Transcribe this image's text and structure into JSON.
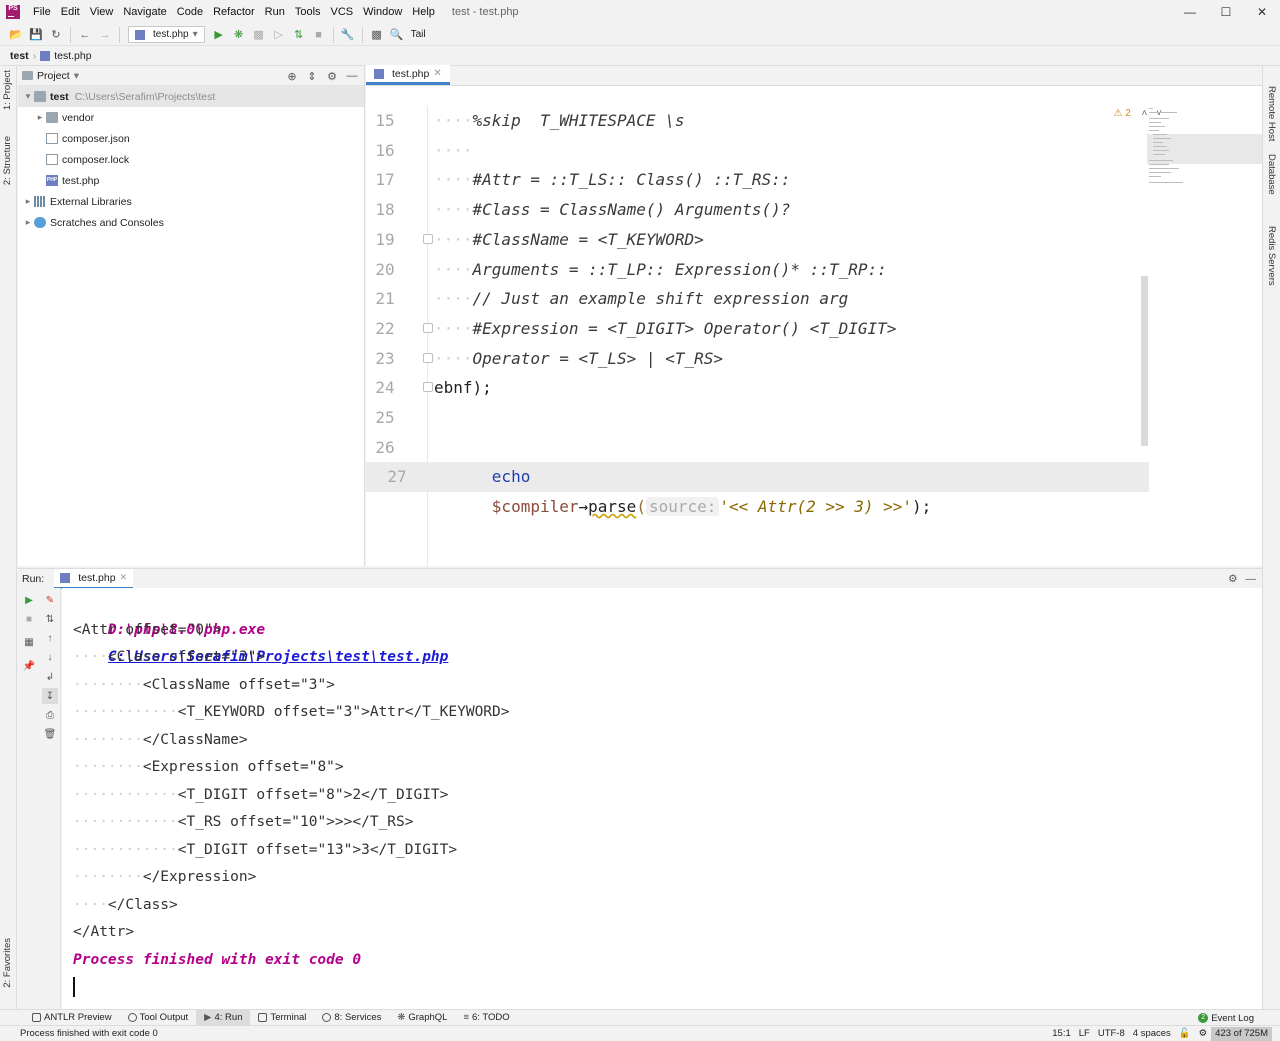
{
  "window": {
    "title": "test - test.php"
  },
  "menu": [
    "File",
    "Edit",
    "View",
    "Navigate",
    "Code",
    "Refactor",
    "Run",
    "Tools",
    "VCS",
    "Window",
    "Help"
  ],
  "toolbar": {
    "run_config": "test.php",
    "tail_label": "Tail"
  },
  "breadcrumb": [
    "test",
    "test.php"
  ],
  "left_stripe": {
    "project": "1: Project",
    "structure": "2: Structure",
    "favorites": "2: Favorites"
  },
  "right_stripe": [
    "Remote Host",
    "Database",
    "Redis Servers"
  ],
  "project": {
    "header": "Project",
    "root": {
      "name": "test",
      "path": "C:\\Users\\Serafim\\Projects\\test"
    },
    "items": [
      {
        "name": "vendor",
        "type": "folder"
      },
      {
        "name": "composer.json",
        "type": "json"
      },
      {
        "name": "composer.lock",
        "type": "lock"
      },
      {
        "name": "test.php",
        "type": "php"
      }
    ],
    "external_libraries": "External Libraries",
    "scratches": "Scratches and Consoles"
  },
  "editor": {
    "tab": "test.php",
    "warning_count": "2",
    "lines": [
      15,
      16,
      17,
      18,
      19,
      20,
      21,
      22,
      23,
      24,
      25,
      26,
      27
    ],
    "code": {
      "l15": "%skip  T_WHITESPACE \\s",
      "l17": "#Attr = ::T_LS:: Class() ::T_RS::",
      "l18": "#Class = ClassName() Arguments()?",
      "l19": "#ClassName = <T_KEYWORD>",
      "l20": "Arguments = ::T_LP:: Expression()* ::T_RP::",
      "l21": "// Just an example shift expression arg",
      "l22": "#Expression = <T_DIGIT> Operator() <T_DIGIT>",
      "l23": "Operator = <T_LS> | <T_RS>",
      "l24": "ebnf);",
      "l26_kw": "echo",
      "l26_var": "$compiler",
      "l26_arrow": "→",
      "l26_method": "parse",
      "l26_paren": "(",
      "l26_hint": "source:",
      "l26_str": "'<< Attr(2 >> 3) >>'",
      "l26_end": ");"
    }
  },
  "run": {
    "label": "Run:",
    "tab": "test.php",
    "console": {
      "cmd_exe": "D:\\php\\8.0\\php.exe",
      "cmd_file": "C:\\Users\\Serafim\\Projects\\test\\test.php",
      "lines": [
        {
          "indent": "",
          "text": "<Attr offset=\"0\">"
        },
        {
          "indent": "····",
          "text": "<Class offset=\"3\">"
        },
        {
          "indent": "········",
          "text": "<ClassName offset=\"3\">"
        },
        {
          "indent": "············",
          "text": "<T_KEYWORD offset=\"3\">Attr</T_KEYWORD>"
        },
        {
          "indent": "········",
          "text": "</ClassName>"
        },
        {
          "indent": "········",
          "text": "<Expression offset=\"8\">"
        },
        {
          "indent": "············",
          "text": "<T_DIGIT offset=\"8\">2</T_DIGIT>"
        },
        {
          "indent": "············",
          "text": "<T_RS offset=\"10\">>></T_RS>"
        },
        {
          "indent": "············",
          "text": "<T_DIGIT offset=\"13\">3</T_DIGIT>"
        },
        {
          "indent": "········",
          "text": "</Expression>"
        },
        {
          "indent": "····",
          "text": "</Class>"
        },
        {
          "indent": "",
          "text": "</Attr>"
        }
      ],
      "finished": "Process finished with exit code 0"
    }
  },
  "bottom_tabs": [
    {
      "label": "ANTLR Preview"
    },
    {
      "label": "Tool Output"
    },
    {
      "label": "4: Run"
    },
    {
      "label": "Terminal"
    },
    {
      "label": "8: Services"
    },
    {
      "label": "GraphQL"
    },
    {
      "label": "6: TODO"
    }
  ],
  "event_log": {
    "count": "2",
    "label": "Event Log"
  },
  "status": {
    "message": "Process finished with exit code 0",
    "position": "15:1",
    "line_sep": "LF",
    "encoding": "UTF-8",
    "indent": "4 spaces",
    "memory": "423 of 725M"
  }
}
